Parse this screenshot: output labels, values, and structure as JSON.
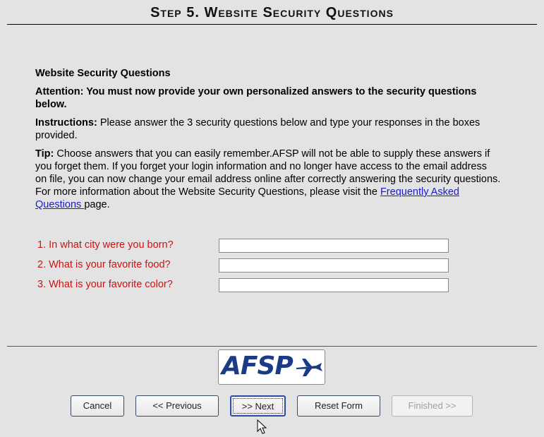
{
  "header": {
    "title": "Step 5. Website Security Questions"
  },
  "content": {
    "section_title": "Website Security Questions",
    "attention": "Attention: You must now provide your own personalized answers to the security questions below.",
    "instructions_label": "Instructions:",
    "instructions_text": " Please answer the 3 security questions below and type your responses in the boxes provided.",
    "tip_label": "Tip:",
    "tip_text": " Choose answers that you can easily remember.AFSP will not be able to supply these answers if you forget them. If you forget your login information and no longer have access to the email address on file, you can now change your email address online after correctly answering the security questions. For more information about the Website Security Questions, please visit the ",
    "faq_link": "Frequently Asked Questions ",
    "tip_suffix": "page."
  },
  "questions": [
    {
      "label": "1. In what city were you born?",
      "value": ""
    },
    {
      "label": "2. What is your favorite food?",
      "value": ""
    },
    {
      "label": "3. What is your favorite color?",
      "value": ""
    }
  ],
  "logo": {
    "text": "AFSP"
  },
  "buttons": {
    "cancel": "Cancel",
    "previous": "<< Previous",
    "next": ">> Next",
    "reset": "Reset Form",
    "finished": "Finished >>"
  },
  "colors": {
    "question_label": "#c81414",
    "link": "#1a1ad6",
    "logo_blue": "#1c3b86",
    "background": "#e3e3e3"
  }
}
